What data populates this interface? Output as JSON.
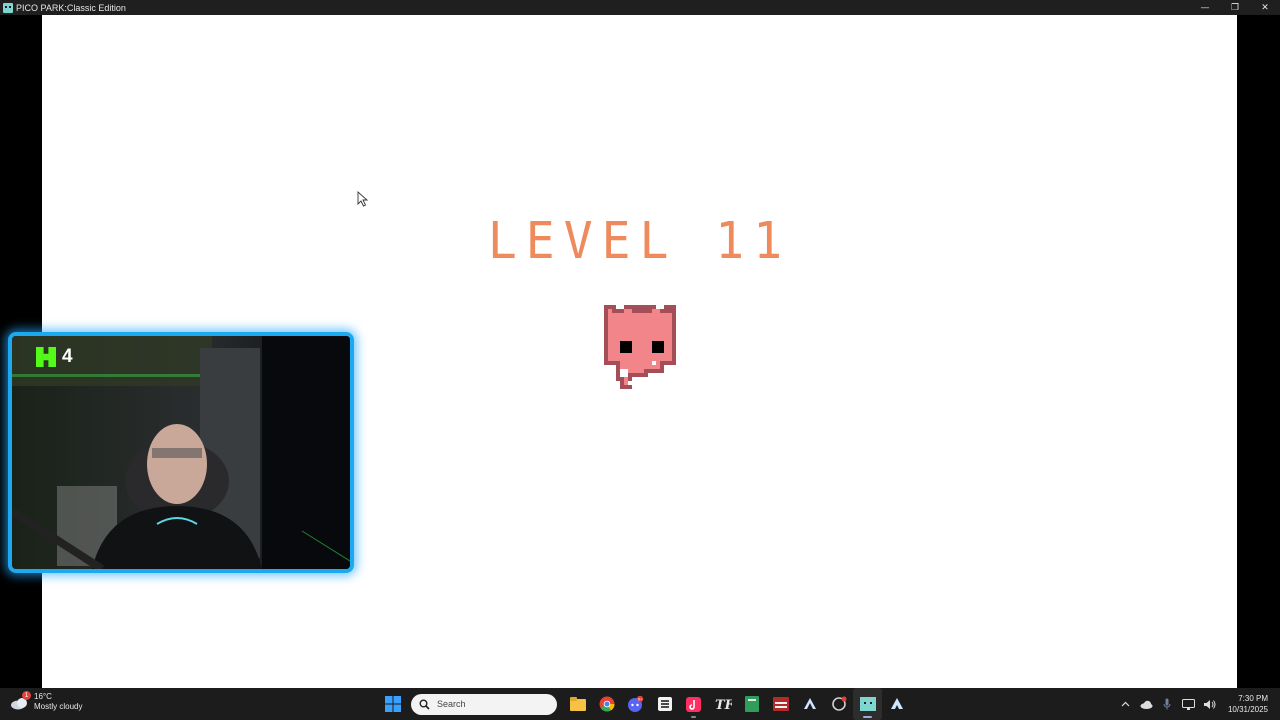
{
  "window": {
    "title": "PICO PARK:Classic Edition",
    "controls": {
      "minimize": "—",
      "restore": "❐",
      "close": "✕"
    }
  },
  "game": {
    "level_title": "LEVEL 11",
    "background": "#ffffff",
    "title_color": "#ee8a5c",
    "character_color": "#f08080"
  },
  "stream_overlay": {
    "platform_icon": "kick-icon",
    "viewer_count": "4",
    "frame_color": "#1ea8f0"
  },
  "taskbar": {
    "weather": {
      "temperature": "16°C",
      "condition": "Mostly cloudy",
      "badge": "1"
    },
    "search_placeholder": "Search",
    "apps": [
      "windows-start-icon",
      "file-explorer-icon",
      "chrome-icon",
      "discord-icon",
      "media-app-icon",
      "tiktok-icon",
      "tf-app-icon",
      "notebook-icon",
      "voicemeeter-icon",
      "steam-icon",
      "refresh-app-icon",
      "pico-park-icon",
      "steam-alt-icon"
    ],
    "discord_badge": "9+",
    "clock": {
      "time": "7:30 PM",
      "date": "10/31/2025"
    }
  }
}
